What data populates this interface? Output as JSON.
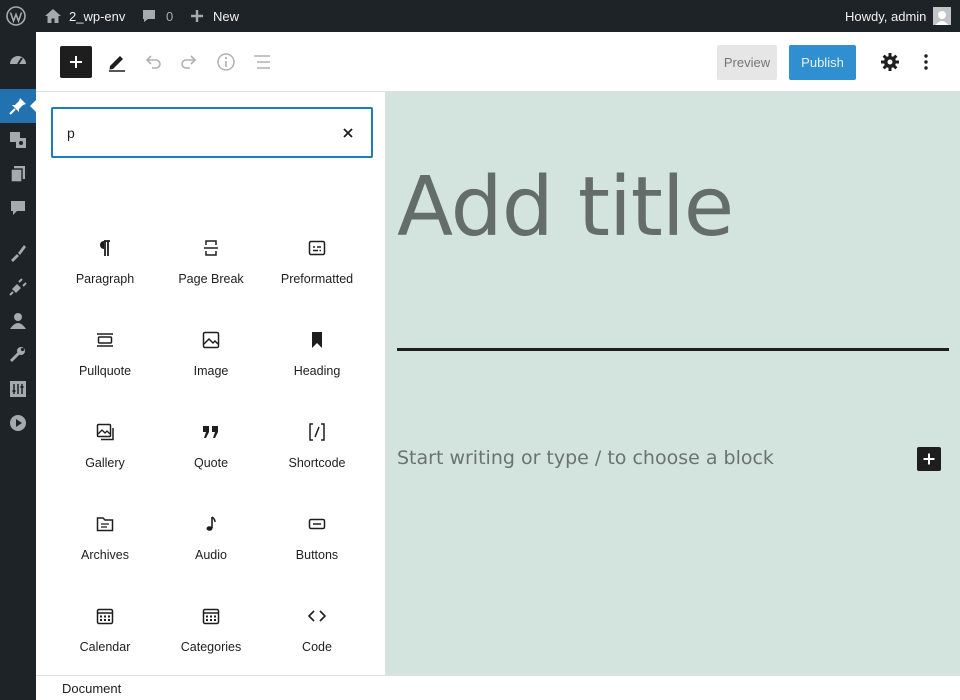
{
  "admin_bar": {
    "site_name": "2_wp-env",
    "comments_count": "0",
    "new_label": "New",
    "greeting": "Howdy, admin"
  },
  "admin_menu": {
    "items": [
      {
        "icon": "dashboard-icon",
        "active": false
      },
      {
        "icon": "posts-pin-icon",
        "active": true
      },
      {
        "icon": "media-icon",
        "active": false
      },
      {
        "icon": "pages-icon",
        "active": false
      },
      {
        "icon": "comments-icon",
        "active": false
      },
      {
        "icon": "appearance-icon",
        "active": false
      },
      {
        "icon": "plugins-icon",
        "active": false
      },
      {
        "icon": "users-icon",
        "active": false
      },
      {
        "icon": "tools-icon",
        "active": false
      },
      {
        "icon": "settings-icon",
        "active": false
      },
      {
        "icon": "media-play-icon",
        "active": false
      }
    ]
  },
  "toolbar": {
    "preview_label": "Preview",
    "publish_label": "Publish"
  },
  "inserter": {
    "search_value": "p",
    "blocks": [
      {
        "label": "Paragraph",
        "icon": "paragraph-icon"
      },
      {
        "label": "Page Break",
        "icon": "page-break-icon"
      },
      {
        "label": "Preformatted",
        "icon": "preformatted-icon"
      },
      {
        "label": "Pullquote",
        "icon": "pullquote-icon"
      },
      {
        "label": "Image",
        "icon": "image-icon"
      },
      {
        "label": "Heading",
        "icon": "heading-bookmark-icon"
      },
      {
        "label": "Gallery",
        "icon": "gallery-icon"
      },
      {
        "label": "Quote",
        "icon": "quote-icon"
      },
      {
        "label": "Shortcode",
        "icon": "shortcode-icon"
      },
      {
        "label": "Archives",
        "icon": "archives-icon"
      },
      {
        "label": "Audio",
        "icon": "audio-icon"
      },
      {
        "label": "Buttons",
        "icon": "buttons-icon"
      },
      {
        "label": "Calendar",
        "icon": "calendar-icon"
      },
      {
        "label": "Categories",
        "icon": "categories-icon"
      },
      {
        "label": "Code",
        "icon": "code-icon"
      }
    ]
  },
  "editor": {
    "title_placeholder": "Add title",
    "paragraph_placeholder": "Start writing or type / to choose a block"
  },
  "footer": {
    "breadcrumb": "Document"
  },
  "colors": {
    "publish": "#2f8fd0",
    "canvas_bg": "#d3e4de",
    "admin_bar": "#1d2327",
    "active_menu": "#2271b1"
  }
}
